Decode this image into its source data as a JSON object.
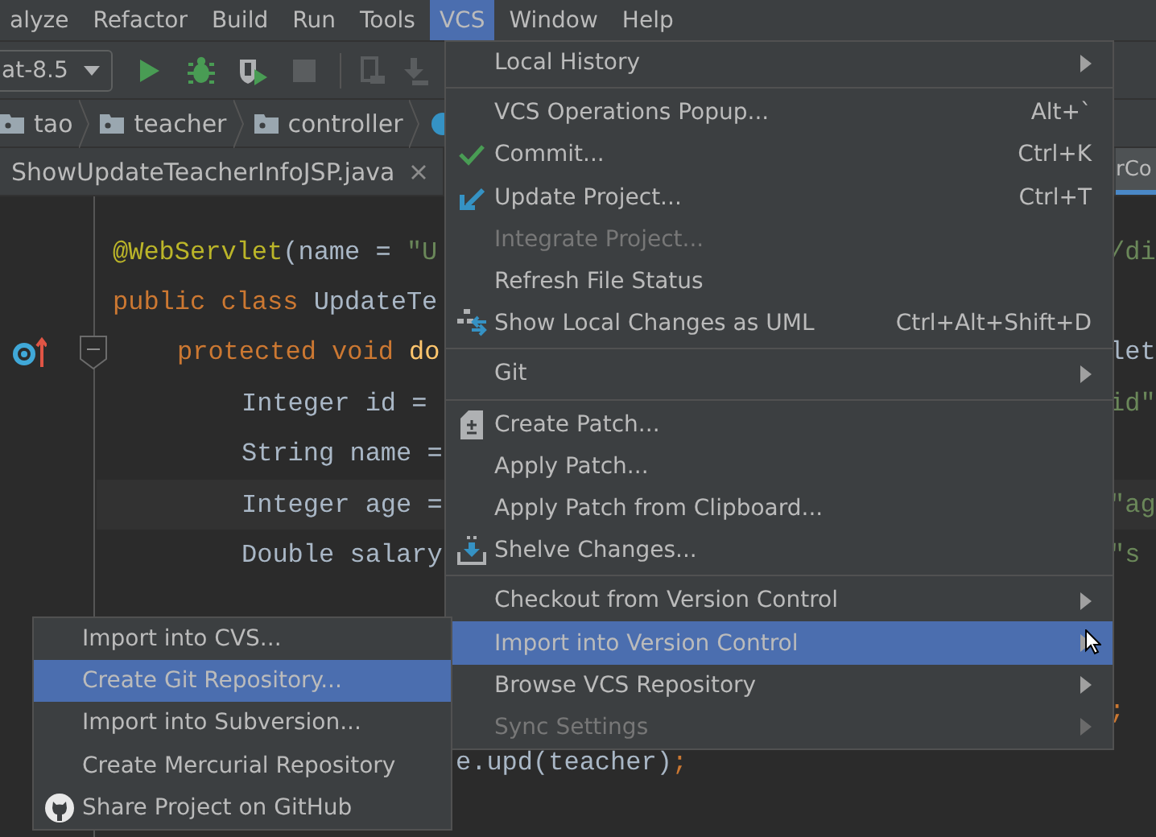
{
  "menubar": {
    "items": [
      {
        "label": "alyze",
        "selected": false
      },
      {
        "label": "Refactor",
        "selected": false
      },
      {
        "label": "Build",
        "selected": false
      },
      {
        "label": "Run",
        "selected": false
      },
      {
        "label": "Tools",
        "selected": false
      },
      {
        "label": "VCS",
        "selected": true
      },
      {
        "label": "Window",
        "selected": false
      },
      {
        "label": "Help",
        "selected": false
      }
    ]
  },
  "toolbar": {
    "run_config": "at-8.5",
    "buttons": [
      {
        "kind": "run",
        "disabled": false
      },
      {
        "kind": "debug",
        "disabled": false
      },
      {
        "kind": "coverage",
        "disabled": false
      },
      {
        "kind": "stop",
        "disabled": true
      },
      {
        "kind": "attach",
        "disabled": true
      },
      {
        "kind": "download",
        "disabled": true
      }
    ]
  },
  "breadcrumbs": [
    {
      "kind": "folder",
      "label": "tao"
    },
    {
      "kind": "folder",
      "label": "teacher"
    },
    {
      "kind": "folder",
      "label": "controller"
    },
    {
      "kind": "class"
    }
  ],
  "tabs": [
    {
      "label": "ShowUpdateTeacherInfoJSP.java",
      "selected": false,
      "closable": true
    },
    {
      "label": "rCo",
      "selected": true,
      "closable": false
    }
  ],
  "editor": {
    "lines": [
      {
        "tokens": [
          {
            "text": "@WebServlet",
            "kind": "annotation"
          },
          {
            "text": "(name = ",
            "kind": "plain"
          },
          {
            "text": "\"U",
            "kind": "string"
          }
        ],
        "tail": [
          {
            "text": "/di",
            "kind": "string"
          }
        ],
        "current": false,
        "override": false,
        "foldable": false
      },
      {
        "tokens": [
          {
            "text": "public class ",
            "kind": "keyword"
          },
          {
            "text": "UpdateTe",
            "kind": "plain"
          }
        ],
        "current": false,
        "override": false,
        "foldable": false,
        "children": [
          {
            "tokens": [
              {
                "text": "protected void ",
                "kind": "keyword"
              },
              {
                "text": "do",
                "kind": "method"
              }
            ],
            "tail": [
              {
                "text": "let",
                "kind": "plain"
              }
            ],
            "current": false,
            "override": true,
            "foldable": true,
            "children": [
              {
                "tokens": [
                  {
                    "text": "Integer id =",
                    "kind": "plain"
                  }
                ],
                "tail": [
                  {
                    "text": "id\"",
                    "kind": "string"
                  }
                ],
                "current": false,
                "override": false,
                "foldable": false
              },
              {
                "tokens": [
                  {
                    "text": "String name =",
                    "kind": "plain"
                  }
                ],
                "current": false,
                "override": false,
                "foldable": false
              },
              {
                "tokens": [
                  {
                    "text": "Integer age =",
                    "kind": "plain"
                  }
                ],
                "tail": [
                  {
                    "text": "\"ag",
                    "kind": "string"
                  }
                ],
                "current": true,
                "override": false,
                "foldable": false
              },
              {
                "tokens": [
                  {
                    "text": "Double salary",
                    "kind": "plain"
                  }
                ],
                "tail": [
                  {
                    "text": "\"s",
                    "kind": "string"
                  }
                ],
                "current": false,
                "override": false,
                "foldable": false
              }
            ]
          }
        ]
      }
    ],
    "lower_lines": [
      {
        "tail": [
          {
            "text": ";",
            "kind": "keyword"
          }
        ],
        "current": false,
        "override": false,
        "foldable": false
      },
      {
        "middle": [
          {
            "text": "e.upd(teacher)",
            "kind": "plain"
          },
          {
            "text": ";",
            "kind": "keyword"
          }
        ],
        "current": false,
        "override": false,
        "foldable": false
      }
    ]
  },
  "vcs_menu": {
    "groups": [
      [
        {
          "label": "Local History",
          "kind": "submenu",
          "selected": false,
          "disabled": false
        }
      ],
      [
        {
          "label": "VCS Operations Popup...",
          "shortcut": "Alt+`",
          "kind": "action",
          "selected": false,
          "disabled": false
        },
        {
          "label": "Commit...",
          "shortcut": "Ctrl+K",
          "kind": "commit",
          "selected": false,
          "disabled": false
        },
        {
          "label": "Update Project...",
          "shortcut": "Ctrl+T",
          "kind": "update",
          "selected": false,
          "disabled": false
        },
        {
          "label": "Integrate Project...",
          "kind": "action",
          "selected": false,
          "disabled": true
        },
        {
          "label": "Refresh File Status",
          "kind": "action",
          "selected": false,
          "disabled": false
        },
        {
          "label": "Show Local Changes as UML",
          "shortcut": "Ctrl+Alt+Shift+D",
          "kind": "uml",
          "selected": false,
          "disabled": false
        }
      ],
      [
        {
          "label": "Git",
          "kind": "submenu",
          "selected": false,
          "disabled": false
        }
      ],
      [
        {
          "label": "Create Patch...",
          "kind": "patch",
          "selected": false,
          "disabled": false
        },
        {
          "label": "Apply Patch...",
          "kind": "action",
          "selected": false,
          "disabled": false
        },
        {
          "label": "Apply Patch from Clipboard...",
          "kind": "action",
          "selected": false,
          "disabled": false
        },
        {
          "label": "Shelve Changes...",
          "kind": "shelve",
          "selected": false,
          "disabled": false
        }
      ],
      [
        {
          "label": "Checkout from Version Control",
          "kind": "submenu",
          "selected": false,
          "disabled": false
        },
        {
          "label": "Import into Version Control",
          "kind": "submenu",
          "selected": true,
          "disabled": false
        },
        {
          "label": "Browse VCS Repository",
          "kind": "submenu",
          "selected": false,
          "disabled": false
        },
        {
          "label": "Sync Settings",
          "kind": "submenu",
          "selected": false,
          "disabled": true
        }
      ]
    ]
  },
  "import_submenu": {
    "items": [
      {
        "label": "Import into CVS...",
        "kind": "action",
        "selected": false,
        "disabled": false
      },
      {
        "label": "Create Git Repository...",
        "kind": "action",
        "selected": true,
        "disabled": false
      },
      {
        "label": "Import into Subversion...",
        "kind": "action",
        "selected": false,
        "disabled": false
      },
      {
        "label": "Create Mercurial Repository",
        "kind": "action",
        "selected": false,
        "disabled": false
      },
      {
        "label": "Share Project on GitHub",
        "kind": "github",
        "selected": false,
        "disabled": false
      }
    ]
  }
}
